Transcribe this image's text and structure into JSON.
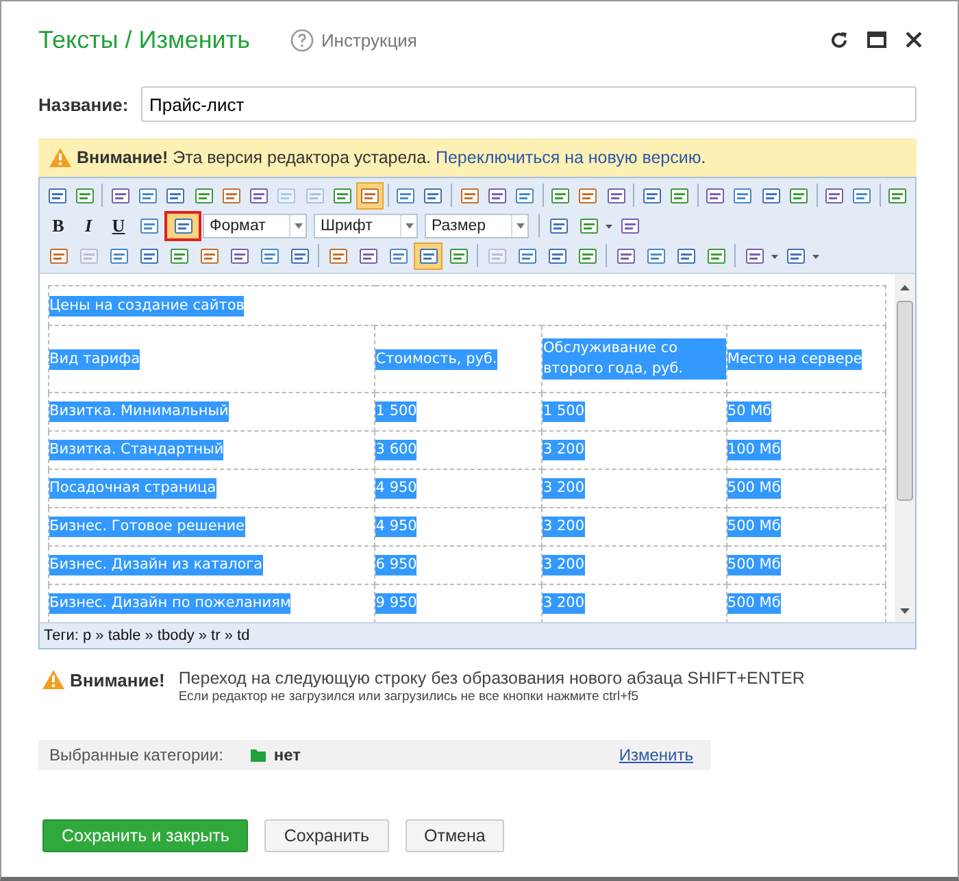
{
  "window": {
    "title": "Тексты / Изменить",
    "help_link": "Инструкция"
  },
  "name_field": {
    "label": "Название:",
    "value": "Прайс-лист"
  },
  "notice": {
    "title": "Внимание!",
    "text": "Эта версия редактора устарела.",
    "link": "Переключиться на новую версию",
    "tail": "."
  },
  "toolbar": {
    "rows": [
      [
        {
          "kind": "icon",
          "on": false,
          "disabled": false,
          "framed": false
        },
        {
          "kind": "icon",
          "on": false,
          "disabled": false,
          "framed": false
        },
        {
          "kind": "sep"
        },
        {
          "kind": "icon",
          "on": false,
          "disabled": false,
          "framed": false
        },
        {
          "kind": "icon",
          "on": false,
          "disabled": false,
          "framed": false
        },
        {
          "kind": "icon",
          "on": false,
          "disabled": false,
          "framed": false
        },
        {
          "kind": "icon",
          "on": false,
          "disabled": false,
          "framed": false
        },
        {
          "kind": "icon",
          "on": false,
          "disabled": false,
          "framed": false
        },
        {
          "kind": "icon",
          "on": false,
          "disabled": false,
          "framed": false
        },
        {
          "kind": "icon",
          "on": false,
          "disabled": true,
          "framed": false
        },
        {
          "kind": "icon",
          "on": false,
          "disabled": true,
          "framed": false
        },
        {
          "kind": "icon",
          "on": false,
          "disabled": false,
          "framed": false
        },
        {
          "kind": "icon",
          "on": true,
          "disabled": false,
          "framed": false
        },
        {
          "kind": "sep"
        },
        {
          "kind": "icon",
          "on": false,
          "disabled": false,
          "framed": false
        },
        {
          "kind": "icon",
          "on": false,
          "disabled": false,
          "framed": false
        },
        {
          "kind": "sep"
        },
        {
          "kind": "icon",
          "on": false,
          "disabled": false,
          "framed": false
        },
        {
          "kind": "icon",
          "on": false,
          "disabled": false,
          "framed": false
        },
        {
          "kind": "icon",
          "on": false,
          "disabled": false,
          "framed": false
        },
        {
          "kind": "sep"
        },
        {
          "kind": "icon",
          "on": false,
          "disabled": false,
          "framed": false
        },
        {
          "kind": "icon",
          "on": false,
          "disabled": false,
          "framed": false
        },
        {
          "kind": "icon",
          "on": false,
          "disabled": false,
          "framed": false
        },
        {
          "kind": "sep"
        },
        {
          "kind": "icon",
          "on": false,
          "disabled": false,
          "framed": false
        },
        {
          "kind": "icon",
          "on": false,
          "disabled": false,
          "framed": false
        },
        {
          "kind": "sep"
        },
        {
          "kind": "icon",
          "on": false,
          "disabled": false,
          "framed": false
        },
        {
          "kind": "icon",
          "on": false,
          "disabled": false,
          "framed": false
        },
        {
          "kind": "icon",
          "on": false,
          "disabled": false,
          "framed": false
        },
        {
          "kind": "icon",
          "on": false,
          "disabled": false,
          "framed": false
        },
        {
          "kind": "sep"
        },
        {
          "kind": "icon",
          "on": false,
          "disabled": false,
          "framed": false
        },
        {
          "kind": "icon",
          "on": false,
          "disabled": false,
          "framed": false
        },
        {
          "kind": "sep"
        },
        {
          "kind": "icon",
          "on": false,
          "disabled": false,
          "framed": false
        }
      ],
      [
        {
          "kind": "bold",
          "label": "B"
        },
        {
          "kind": "italic",
          "label": "I"
        },
        {
          "kind": "underline",
          "label": "U"
        },
        {
          "kind": "icon",
          "on": false,
          "disabled": false,
          "framed": false
        },
        {
          "kind": "icon",
          "on": true,
          "disabled": false,
          "framed": true
        },
        {
          "kind": "select",
          "label": "Формат"
        },
        {
          "kind": "select",
          "label": "Шрифт"
        },
        {
          "kind": "select",
          "label": "Размер"
        },
        {
          "kind": "sep"
        },
        {
          "kind": "icon",
          "on": false,
          "disabled": false,
          "framed": false
        },
        {
          "kind": "icon",
          "on": false,
          "disabled": false,
          "framed": false
        },
        {
          "kind": "caret"
        },
        {
          "kind": "icon",
          "on": false,
          "disabled": false,
          "framed": false
        }
      ],
      [
        {
          "kind": "icon",
          "on": false,
          "disabled": false,
          "framed": false
        },
        {
          "kind": "icon",
          "on": false,
          "disabled": true,
          "framed": false
        },
        {
          "kind": "icon",
          "on": false,
          "disabled": false,
          "framed": false
        },
        {
          "kind": "icon",
          "on": false,
          "disabled": false,
          "framed": false
        },
        {
          "kind": "icon",
          "on": false,
          "disabled": false,
          "framed": false
        },
        {
          "kind": "icon",
          "on": false,
          "disabled": false,
          "framed": false
        },
        {
          "kind": "icon",
          "on": false,
          "disabled": false,
          "framed": false
        },
        {
          "kind": "icon",
          "on": false,
          "disabled": false,
          "framed": false
        },
        {
          "kind": "icon",
          "on": false,
          "disabled": false,
          "framed": false
        },
        {
          "kind": "sep"
        },
        {
          "kind": "icon",
          "on": false,
          "disabled": false,
          "framed": false
        },
        {
          "kind": "icon",
          "on": false,
          "disabled": false,
          "framed": false
        },
        {
          "kind": "icon",
          "on": false,
          "disabled": false,
          "framed": false
        },
        {
          "kind": "icon",
          "on": true,
          "disabled": false,
          "framed": false
        },
        {
          "kind": "icon",
          "on": false,
          "disabled": false,
          "framed": false
        },
        {
          "kind": "sep"
        },
        {
          "kind": "icon",
          "on": false,
          "disabled": true,
          "framed": false
        },
        {
          "kind": "icon",
          "on": false,
          "disabled": false,
          "framed": false
        },
        {
          "kind": "icon",
          "on": false,
          "disabled": false,
          "framed": false
        },
        {
          "kind": "icon",
          "on": false,
          "disabled": false,
          "framed": false
        },
        {
          "kind": "sep"
        },
        {
          "kind": "icon",
          "on": false,
          "disabled": false,
          "framed": false
        },
        {
          "kind": "icon",
          "on": false,
          "disabled": false,
          "framed": false
        },
        {
          "kind": "icon",
          "on": false,
          "disabled": false,
          "framed": false
        },
        {
          "kind": "icon",
          "on": false,
          "disabled": false,
          "framed": false
        },
        {
          "kind": "sep"
        },
        {
          "kind": "icon",
          "on": false,
          "disabled": false,
          "framed": false
        },
        {
          "kind": "caret"
        },
        {
          "kind": "icon",
          "on": false,
          "disabled": false,
          "framed": false
        },
        {
          "kind": "caret"
        }
      ]
    ]
  },
  "document": {
    "caption": "Цены на создание сайтов",
    "columns": [
      "Вид тарифа",
      "Стоимость, руб.",
      "Обслуживание со второго года, руб.",
      "Место на сервере"
    ],
    "rows": [
      [
        "Визитка. Минимальный",
        "1 500",
        "1 500",
        "50 Мб"
      ],
      [
        "Визитка. Стандартный",
        "3 600",
        "3 200",
        "100 Мб"
      ],
      [
        "Посадочная страница",
        "4 950",
        "3 200",
        "500 Мб"
      ],
      [
        "Бизнес. Готовое решение",
        "4 950",
        "3 200",
        "500 Мб"
      ],
      [
        "Бизнес. Дизайн из каталога",
        "6 950",
        "3 200",
        "500 Мб"
      ],
      [
        "Бизнес. Дизайн по пожеланиям",
        "9 950",
        "3 200",
        "500 Мб"
      ]
    ],
    "selected": true
  },
  "tag_path": "Теги: p » table » tbody » tr » td",
  "hint": {
    "title": "Внимание!",
    "line_1": "Переход на следующую строку без образования нового абзаца SHIFT+ENTER",
    "line_2": "Если редактор не загрузился или загрузились не все кнопки нажмите ctrl+f5"
  },
  "categories": {
    "label": "Выбранные категории:",
    "value": "нет",
    "link": "Изменить"
  },
  "buttons": [
    {
      "label": "Сохранить и закрыть",
      "kind": "primary"
    },
    {
      "label": "Сохранить",
      "kind": "default"
    },
    {
      "label": "Отмена",
      "kind": "default"
    }
  ]
}
